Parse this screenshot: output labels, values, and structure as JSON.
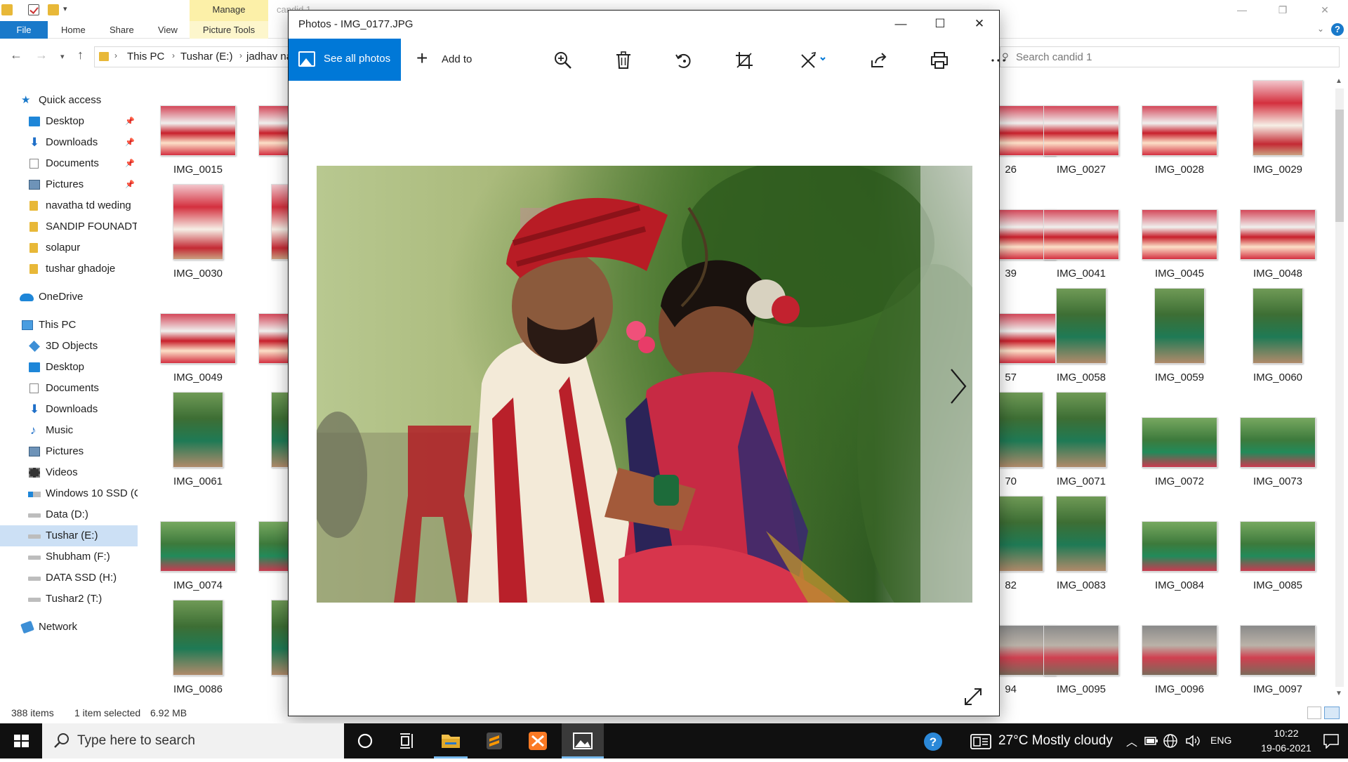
{
  "explorer": {
    "title_faint": "candid 1",
    "manage_tab": "Manage",
    "ribbon_tabs": [
      "File",
      "Home",
      "Share",
      "View",
      "Picture Tools"
    ],
    "breadcrumb": [
      "This PC",
      "Tushar (E:)",
      "jadhav na"
    ],
    "search_placeholder": "Search candid 1",
    "nav": {
      "quick_access": "Quick access",
      "quick_items": [
        "Desktop",
        "Downloads",
        "Documents",
        "Pictures",
        "navatha td weding",
        "SANDIP FOUNADTIO",
        "solapur",
        "tushar ghadoje"
      ],
      "onedrive": "OneDrive",
      "this_pc": "This PC",
      "pc_items": [
        "3D Objects",
        "Desktop",
        "Documents",
        "Downloads",
        "Music",
        "Pictures",
        "Videos",
        "Windows 10 SSD (C",
        "Data (D:)",
        "Tushar (E:)",
        "Shubham (F:)",
        "DATA SSD (H:)",
        "Tushar2 (T:)"
      ],
      "network": "Network"
    },
    "files_left": [
      {
        "name": "IMG_0015",
        "orient": "land",
        "tone": "wedding-land"
      },
      {
        "name": "IMG_0030",
        "orient": "port",
        "tone": "wedding-port"
      },
      {
        "name": "IMG_0049",
        "orient": "land",
        "tone": "wedding-land"
      },
      {
        "name": "IMG_0061",
        "orient": "port",
        "tone": "green-port"
      },
      {
        "name": "IMG_0074",
        "orient": "land",
        "tone": "green-land"
      },
      {
        "name": "IMG_0086",
        "orient": "port",
        "tone": "green-port"
      }
    ],
    "files_partial_left": [
      "IM",
      "IM",
      "IM",
      "IM",
      "IM",
      "IM"
    ],
    "files_partial_right": [
      "26",
      "39",
      "57",
      "70",
      "82",
      "94"
    ],
    "files_right": [
      {
        "name": "IMG_0027",
        "orient": "land",
        "tone": "wedding-land"
      },
      {
        "name": "IMG_0028",
        "orient": "land",
        "tone": "wedding-land"
      },
      {
        "name": "IMG_0029",
        "orient": "port",
        "tone": "wedding-port"
      },
      {
        "name": "IMG_0041",
        "orient": "land",
        "tone": "wedding-land"
      },
      {
        "name": "IMG_0045",
        "orient": "land",
        "tone": "wedding-land"
      },
      {
        "name": "IMG_0048",
        "orient": "land",
        "tone": "wedding-land"
      },
      {
        "name": "IMG_0058",
        "orient": "port",
        "tone": "green-port"
      },
      {
        "name": "IMG_0059",
        "orient": "port",
        "tone": "green-port"
      },
      {
        "name": "IMG_0060",
        "orient": "port",
        "tone": "green-port"
      },
      {
        "name": "IMG_0071",
        "orient": "port",
        "tone": "green-port"
      },
      {
        "name": "IMG_0072",
        "orient": "land",
        "tone": "green-land"
      },
      {
        "name": "IMG_0073",
        "orient": "land",
        "tone": "green-land"
      },
      {
        "name": "IMG_0083",
        "orient": "port",
        "tone": "green-port"
      },
      {
        "name": "IMG_0084",
        "orient": "land",
        "tone": "green-land"
      },
      {
        "name": "IMG_0085",
        "orient": "land",
        "tone": "green-land"
      },
      {
        "name": "IMG_0095",
        "orient": "land",
        "tone": "grey-land"
      },
      {
        "name": "IMG_0096",
        "orient": "land",
        "tone": "grey-land"
      },
      {
        "name": "IMG_0097",
        "orient": "land",
        "tone": "grey-land"
      }
    ],
    "status": {
      "count": "388 items",
      "selected": "1 item selected",
      "size": "6.92 MB"
    }
  },
  "photos": {
    "title": "Photos - IMG_0177.JPG",
    "see_all_label": "See all photos",
    "add_to_label": "Add to",
    "tools": [
      "zoom-icon",
      "delete-icon",
      "rotate-icon",
      "crop-icon",
      "edit-icon",
      "share-icon",
      "print-icon",
      "more-icon"
    ],
    "accent": "#0078d7"
  },
  "taskbar": {
    "search_placeholder": "Type here to search",
    "weather": "27°C  Mostly cloudy",
    "language": "ENG",
    "time": "10:22",
    "date": "19-06-2021"
  }
}
